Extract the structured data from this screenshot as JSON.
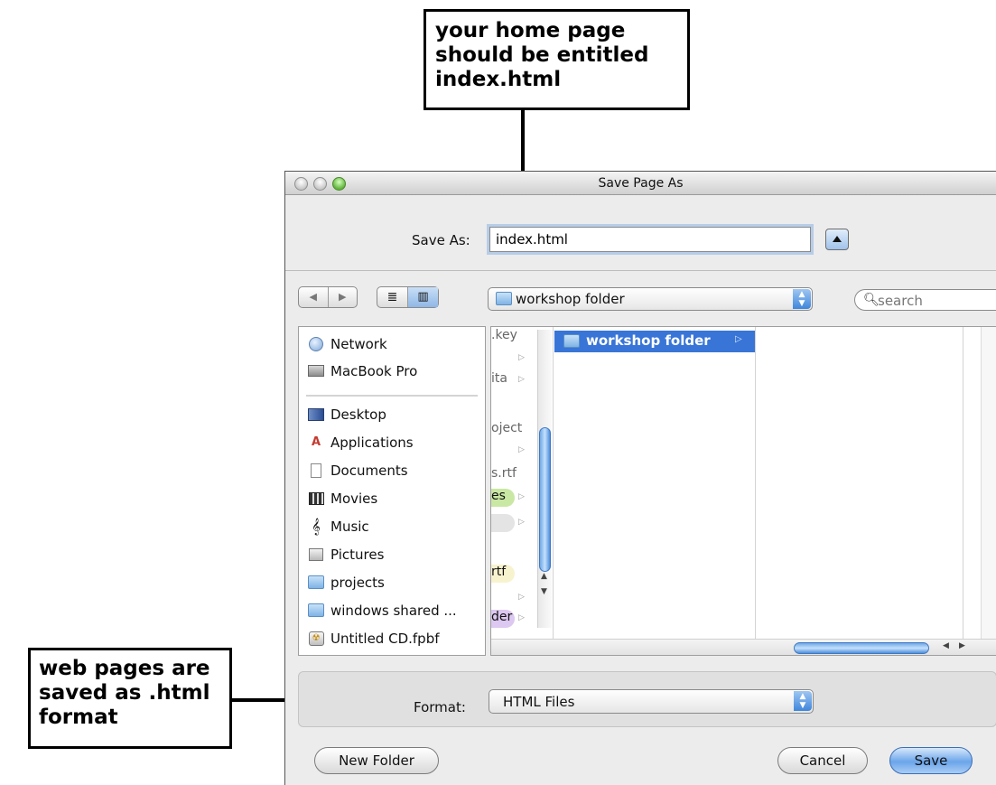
{
  "annotations": {
    "top_callout": [
      "your home page",
      "should be entitled",
      "index.html"
    ],
    "left_callout": [
      "web pages are",
      "saved as .html",
      "format"
    ]
  },
  "dialog": {
    "title": "Save Page As",
    "save_as_label": "Save As:",
    "filename": "index.html",
    "location": "workshop folder",
    "search_placeholder": "search",
    "sidebar_items": [
      {
        "label": "Network",
        "icon": "network-icon"
      },
      {
        "label": "MacBook Pro",
        "icon": "hard-drive-icon"
      },
      {
        "label": "Desktop",
        "icon": "desktop-icon"
      },
      {
        "label": "Applications",
        "icon": "applications-icon"
      },
      {
        "label": "Documents",
        "icon": "documents-icon"
      },
      {
        "label": "Movies",
        "icon": "movies-icon"
      },
      {
        "label": "Music",
        "icon": "music-icon"
      },
      {
        "label": "Pictures",
        "icon": "pictures-icon"
      },
      {
        "label": "projects",
        "icon": "folder-icon"
      },
      {
        "label": "windows shared ...",
        "icon": "folder-icon"
      },
      {
        "label": "Untitled CD.fpbf",
        "icon": "disc-image-icon"
      }
    ],
    "column1_items": [
      {
        "label": ".key",
        "arrow": false
      },
      {
        "label": "",
        "arrow": true
      },
      {
        "label": "ita",
        "arrow": true
      },
      {
        "label": "",
        "arrow": false
      },
      {
        "label": "oject",
        "arrow": false
      },
      {
        "label": "",
        "arrow": true
      },
      {
        "label": "s.rtf",
        "arrow": false
      },
      {
        "label": "es",
        "arrow": true,
        "pill": "#c9e8a3"
      },
      {
        "label": "",
        "arrow": true,
        "pill": "#e4e4e4"
      },
      {
        "label": "",
        "arrow": false
      },
      {
        "label": "rtf",
        "arrow": false,
        "pill": "#f8f3cf"
      },
      {
        "label": "",
        "arrow": true
      },
      {
        "label": "der",
        "arrow": true,
        "pill": "#dcc8f0"
      }
    ],
    "selected_folder": "workshop folder",
    "format_label": "Format:",
    "format_value": "HTML Files",
    "buttons": {
      "new_folder": "New Folder",
      "cancel": "Cancel",
      "save": "Save"
    },
    "colors": {
      "selection": "#3875d7",
      "default_button": "#6aa5ea"
    }
  }
}
